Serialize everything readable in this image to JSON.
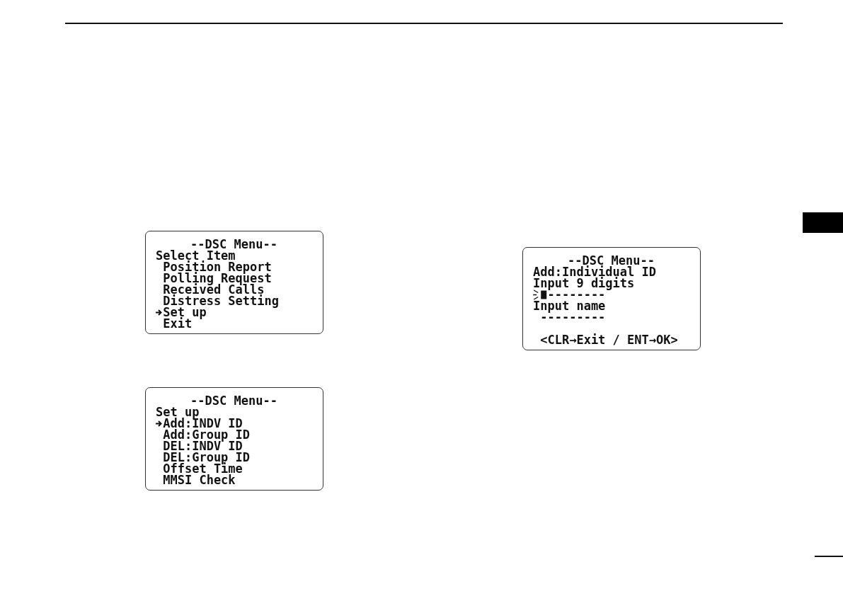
{
  "columns": [
    {
      "screens": [
        {
          "kind": "menu",
          "title": "--DSC Menu--",
          "heading": "Select Item",
          "items": [
            {
              "label": "Position Report",
              "selected": false
            },
            {
              "label": "Polling Request",
              "selected": false
            },
            {
              "label": "Received Calls",
              "selected": false
            },
            {
              "label": "Distress Setting",
              "selected": false
            },
            {
              "label": "Set up",
              "selected": true
            },
            {
              "label": "Exit",
              "selected": false
            }
          ]
        },
        {
          "kind": "menu",
          "title": "--DSC Menu--",
          "heading": "Set up",
          "items": [
            {
              "label": "Add:INDV ID",
              "selected": true
            },
            {
              "label": "Add:Group ID",
              "selected": false
            },
            {
              "label": "DEL:INDV ID",
              "selected": false
            },
            {
              "label": "DEL:Group ID",
              "selected": false
            },
            {
              "label": "Offset Time",
              "selected": false
            },
            {
              "label": "MMSI Check",
              "selected": false
            }
          ]
        }
      ]
    },
    {
      "screens": [
        {
          "kind": "entry",
          "title": "--DSC Menu--",
          "heading": "Add:Individual ID",
          "fields": [
            {
              "label": "Input 9 digits",
              "placeholder": "--------",
              "cursor": true
            },
            {
              "label": "Input name",
              "placeholder": "---------",
              "cursor": false
            }
          ],
          "hint": "<CLR→Exit / ENT→OK>"
        }
      ]
    }
  ]
}
